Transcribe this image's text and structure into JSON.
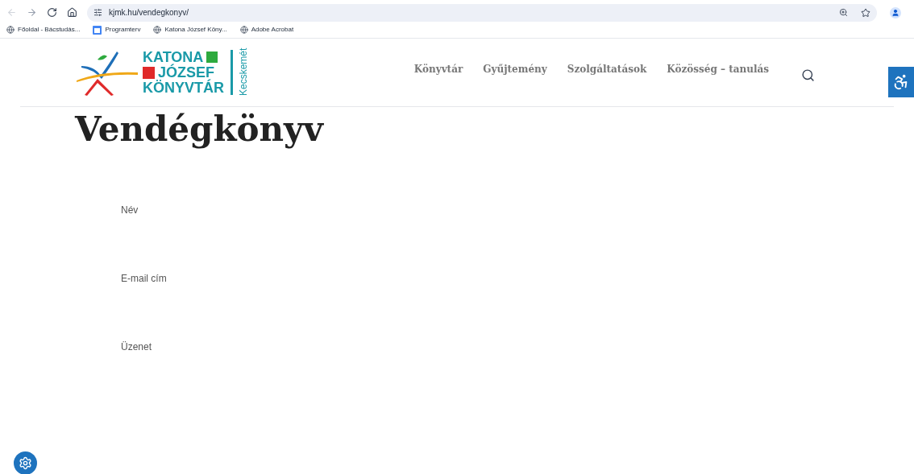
{
  "browser": {
    "url": "kjmk.hu/vendegkonyv/",
    "bookmarks": [
      {
        "label": "Főoldal - Bácstudás...",
        "kind": "globe"
      },
      {
        "label": "Programterv",
        "kind": "calendar"
      },
      {
        "label": "Katona József Köny...",
        "kind": "globe"
      },
      {
        "label": "Adobe Acrobat",
        "kind": "globe"
      }
    ]
  },
  "logo": {
    "lines": [
      "KATONA",
      "JÓZSEF",
      "KÖNYVTÁR"
    ],
    "city": "Kecskemét"
  },
  "nav": {
    "items": [
      "Könyvtár",
      "Gyűjtemény",
      "Szolgáltatások",
      "Közösség – tanulás"
    ]
  },
  "page": {
    "title": "Vendégkönyv"
  },
  "form": {
    "fields": [
      "Név",
      "E-mail cím",
      "Üzenet"
    ]
  }
}
